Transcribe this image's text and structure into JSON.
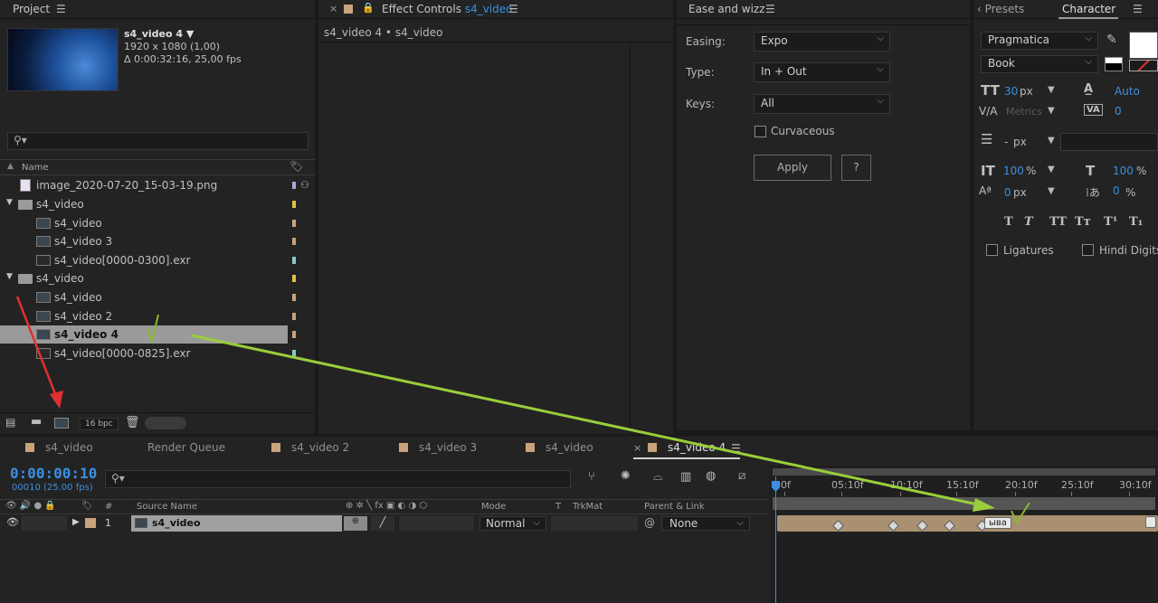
{
  "project": {
    "title": "Project",
    "menu_icon": "burger-icon",
    "item_name": "s4_video 4",
    "item_res": "1920 x 1080 (1,00)",
    "item_dur": "Δ 0:00:32:16, 25,00 fps",
    "col_name": "Name",
    "items": [
      {
        "label": "image_2020-07-20_15-03-19.png",
        "type": "image",
        "tag": "#a8a8d8"
      },
      {
        "label": "s4_video",
        "type": "folder",
        "tag": "#e0c040"
      },
      {
        "label": "s4_video",
        "type": "comp",
        "tag": "#c9a37b"
      },
      {
        "label": "s4_video 3",
        "type": "comp",
        "tag": "#c9a37b"
      },
      {
        "label": "s4_video[0000-0300].exr",
        "type": "footage",
        "tag": "#8ac8c8"
      },
      {
        "label": "s4_video",
        "type": "folder",
        "tag": "#e0c040"
      },
      {
        "label": "s4_video",
        "type": "comp",
        "tag": "#c9a37b"
      },
      {
        "label": "s4_video 2",
        "type": "comp",
        "tag": "#c9a37b"
      },
      {
        "label": "s4_video 4",
        "type": "comp",
        "tag": "#c9a37b"
      },
      {
        "label": "s4_video[0000-0825].exr",
        "type": "footage",
        "tag": "#8ac8c8"
      }
    ],
    "bpc": "16 bpc"
  },
  "effect_controls": {
    "title": "Effect Controls",
    "comp": "s4_video",
    "breadcrumb": "s4_video 4 • s4_video"
  },
  "ease": {
    "title": "Ease and wizz",
    "easing_label": "Easing:",
    "easing_value": "Expo",
    "type_label": "Type:",
    "type_value": "In + Out",
    "keys_label": "Keys:",
    "keys_value": "All",
    "curvaceous": "Curvaceous",
    "apply": "Apply",
    "help": "?"
  },
  "character": {
    "presets_tab": "‹ Presets",
    "title": "Character",
    "font": "Pragmatica",
    "style": "Book",
    "size": "30",
    "size_unit": "px",
    "leading": "Auto",
    "kerning": "Metrics",
    "tracking": "0",
    "indent": "-",
    "indent_unit": "px",
    "vscale": "100",
    "hscale": "100",
    "pct": "%",
    "baseline": "0",
    "baseline_unit": "px",
    "tsume": "0",
    "ligatures": "Ligatures",
    "hindi": "Hindi Digits"
  },
  "timeline": {
    "tabs": [
      "s4_video",
      "Render Queue",
      "s4_video 2",
      "s4_video 3",
      "s4_video",
      "s4_video 4"
    ],
    "timecode": "0:00:00:10",
    "fps": "00010 (25.00 fps)",
    "cols": {
      "num": "#",
      "source": "Source Name",
      "mode": "Mode",
      "t": "T",
      "trkmat": "TrkMat",
      "parent": "Parent & Link"
    },
    "layer": {
      "num": "1",
      "name": "s4_video",
      "mode": "Normal",
      "parent": "None"
    },
    "ruler": [
      "00f",
      "05:10f",
      "10:10f",
      "15:10f",
      "20:10f",
      "25:10f",
      "30:10f"
    ],
    "marker": "ыва"
  }
}
